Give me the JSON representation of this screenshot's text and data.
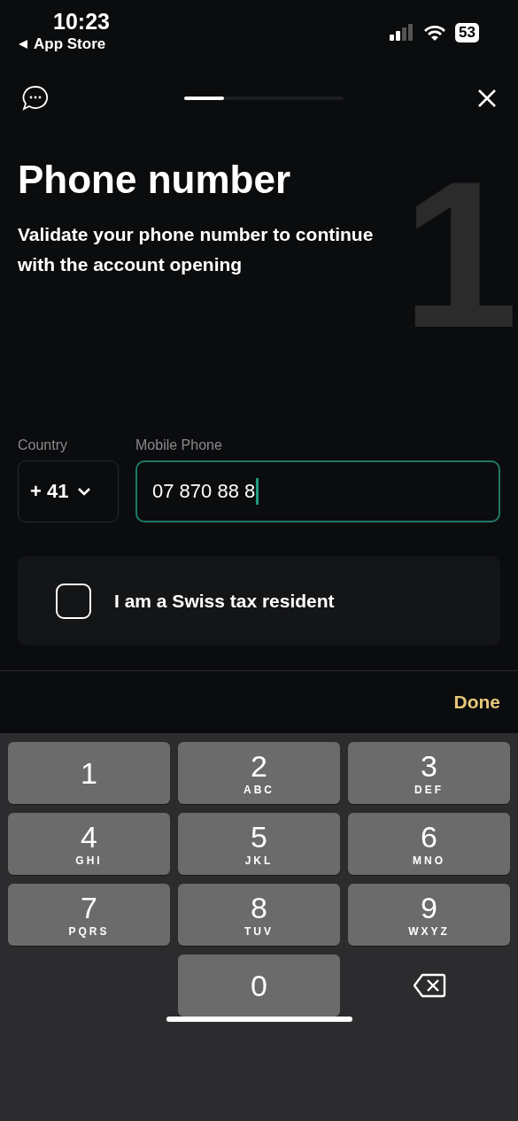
{
  "status_bar": {
    "time": "10:23",
    "back_label": "App Store",
    "battery": "53"
  },
  "header": {
    "progress": {
      "level": 0.25
    }
  },
  "step_number": "1",
  "title": "Phone number",
  "subtitle": "Validate your phone number to continue with the account opening",
  "form": {
    "country": {
      "label": "Country",
      "value": "+ 41"
    },
    "phone": {
      "label": "Mobile Phone",
      "value": "07 870 88 8",
      "focused": true
    }
  },
  "tax_resident": {
    "label": "I am a Swiss tax resident",
    "checked": false
  },
  "keyboard_bar": {
    "done": "Done"
  },
  "keypad": [
    {
      "kind": "digit",
      "digit": "1"
    },
    {
      "kind": "digit",
      "digit": "2",
      "letters": "ABC"
    },
    {
      "kind": "digit",
      "digit": "3",
      "letters": "DEF"
    },
    {
      "kind": "digit",
      "digit": "4",
      "letters": "GHI"
    },
    {
      "kind": "digit",
      "digit": "5",
      "letters": "JKL"
    },
    {
      "kind": "digit",
      "digit": "6",
      "letters": "MNO"
    },
    {
      "kind": "digit",
      "digit": "7",
      "letters": "PQRS"
    },
    {
      "kind": "digit",
      "digit": "8",
      "letters": "TUV"
    },
    {
      "kind": "digit",
      "digit": "9",
      "letters": "WXYZ"
    },
    {
      "kind": "blank"
    },
    {
      "kind": "digit",
      "digit": "0"
    },
    {
      "kind": "delete"
    }
  ]
}
